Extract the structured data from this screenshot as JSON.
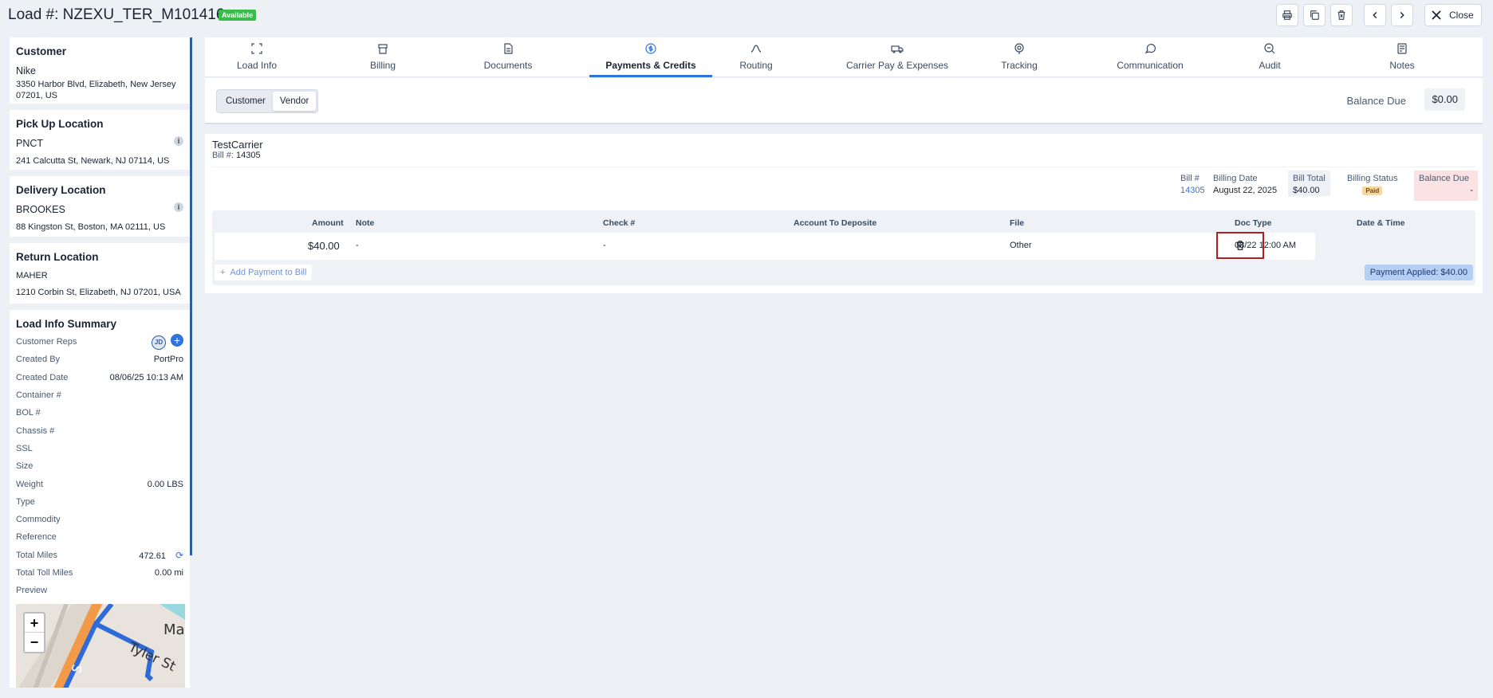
{
  "header": {
    "title": "Load #: NZEXU_TER_M101416",
    "status": "Available",
    "close_label": "Close"
  },
  "sidebar": {
    "customer": {
      "heading": "Customer",
      "name": "Nike",
      "address": "3350 Harbor Blvd, Elizabeth, New Jersey 07201, US"
    },
    "pickup": {
      "heading": "Pick Up Location",
      "name": "PNCT",
      "address": "241 Calcutta St, Newark, NJ 07114, US"
    },
    "delivery": {
      "heading": "Delivery Location",
      "name": "BROOKES",
      "address": "88 Kingston St, Boston, MA 02111, US"
    },
    "return": {
      "heading": "Return Location",
      "name": "MAHER",
      "address": "1210 Corbin St, Elizabeth, NJ 07201, USA"
    },
    "summary": {
      "heading": "Load Info Summary",
      "customer_reps_label": "Customer Reps",
      "rep_initials": "JD",
      "rows": [
        {
          "k": "Created By",
          "v": "PortPro"
        },
        {
          "k": "Created Date",
          "v": "08/06/25 10:13 AM"
        },
        {
          "k": "Container #",
          "v": ""
        },
        {
          "k": "BOL #",
          "v": ""
        },
        {
          "k": "Chassis #",
          "v": ""
        },
        {
          "k": "SSL",
          "v": ""
        },
        {
          "k": "Size",
          "v": ""
        },
        {
          "k": "Weight",
          "v": "0.00 LBS"
        },
        {
          "k": "Type",
          "v": ""
        },
        {
          "k": "Commodity",
          "v": ""
        },
        {
          "k": "Reference",
          "v": ""
        }
      ],
      "total_miles_label": "Total Miles",
      "total_miles": "472.61",
      "toll_miles_label": "Total Toll Miles",
      "toll_miles": "0.00 mi",
      "preview_label": "Preview",
      "map_labels": [
        "Mar",
        "Tyler St",
        "S"
      ]
    }
  },
  "tabs": [
    {
      "label": "Load Info",
      "icon": "load-info-icon"
    },
    {
      "label": "Billing",
      "icon": "billing-icon"
    },
    {
      "label": "Documents",
      "icon": "documents-icon"
    },
    {
      "label": "Payments & Credits",
      "icon": "payments-icon",
      "active": true
    },
    {
      "label": "Routing",
      "icon": "routing-icon"
    },
    {
      "label": "Carrier Pay & Expenses",
      "icon": "carrier-pay-icon"
    },
    {
      "label": "Tracking",
      "icon": "tracking-icon"
    },
    {
      "label": "Communication",
      "icon": "communication-icon"
    },
    {
      "label": "Audit",
      "icon": "audit-icon"
    },
    {
      "label": "Notes",
      "icon": "notes-icon"
    }
  ],
  "subbar": {
    "customer_label": "Customer",
    "vendor_label": "Vendor",
    "balance_due_label": "Balance Due",
    "balance_due_value": "$0.00"
  },
  "bill": {
    "carrier": "TestCarrier",
    "bill_no_label": "Bill #:",
    "bill_no": "14305",
    "meta": {
      "bill_label": "Bill #",
      "bill_value": "14305",
      "date_label": "Billing Date",
      "date_value": "August 22, 2025",
      "total_label": "Bill Total",
      "total_value": "$40.00",
      "status_label": "Billing Status",
      "status_value": "Paid",
      "balance_label": "Balance Due",
      "balance_value": "-"
    },
    "columns": [
      "Amount",
      "Note",
      "Check #",
      "Account To Deposite",
      "File",
      "Doc Type",
      "Date & Time"
    ],
    "row": {
      "amount": "$40.00",
      "note": "-",
      "check": "-",
      "account": "",
      "file": "",
      "doc_type": "Other",
      "datetime": "08/22 12:00 AM"
    },
    "add_payment_label": "Add Payment to Bill",
    "payment_applied": "Payment Applied: $40.00"
  },
  "colors": {
    "accent": "#2f73e0",
    "status_green": "#3cbb4a",
    "highlight_red": "#b21e1e"
  }
}
